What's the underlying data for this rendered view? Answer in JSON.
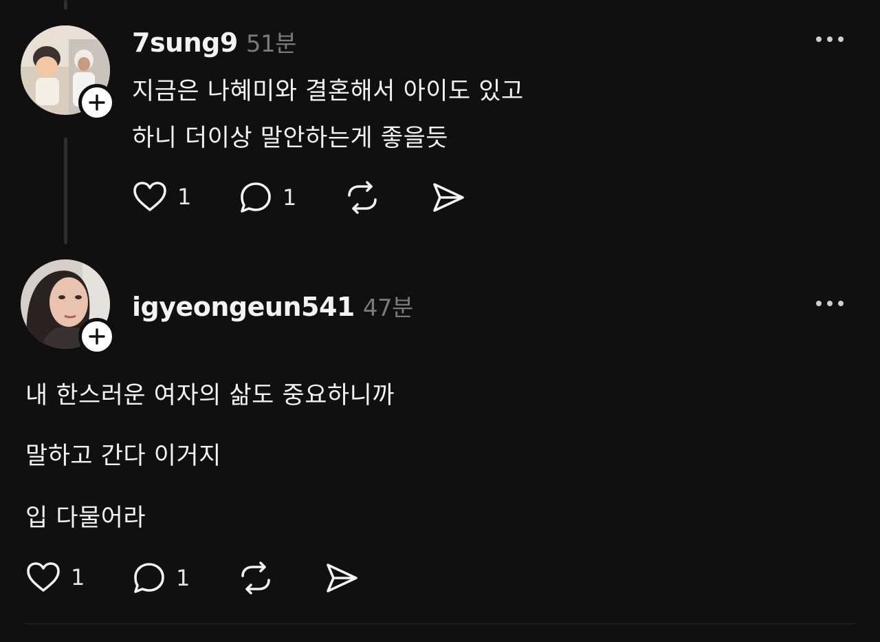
{
  "post1": {
    "username": "7sung9",
    "time": "51분",
    "lines": [
      "지금은 나혜미와 결혼해서 아이도 있고",
      "하니 더이상 말안하는게 좋을듯"
    ],
    "like_count": "1",
    "reply_count": "1"
  },
  "post2": {
    "username": "igyeongeun541",
    "time": "47분",
    "lines": [
      "내 한스러운 여자의 삶도 중요하니까",
      "말하고 간다 이거지",
      "입 다물어라"
    ],
    "like_count": "1",
    "reply_count": "1"
  },
  "icons": {
    "like": "heart-icon",
    "reply": "comment-icon",
    "repost": "repost-icon",
    "share": "send-icon",
    "more": "more-icon",
    "follow": "plus-icon"
  },
  "colors": {
    "background": "#101010",
    "text": "#f3f3f3",
    "muted": "#7a7a7a",
    "thread_line": "#2f2f2f"
  }
}
